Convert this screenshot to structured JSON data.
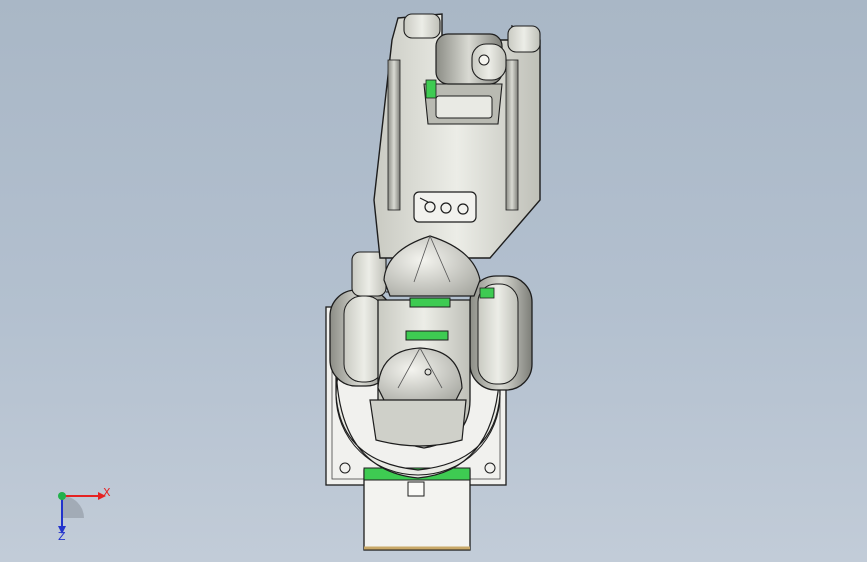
{
  "viewport": {
    "background_top": "#a9b7c6",
    "background_bottom": "#c2ccd8"
  },
  "model": {
    "body_color": "#d8d9d2",
    "edge_color": "#1d1d1d",
    "accent_color": "#3ecb52"
  },
  "triad": {
    "x_label": "X",
    "z_label": "Z",
    "x_color": "#e52222",
    "y_color": "#22b14c",
    "z_color": "#2233cc"
  }
}
